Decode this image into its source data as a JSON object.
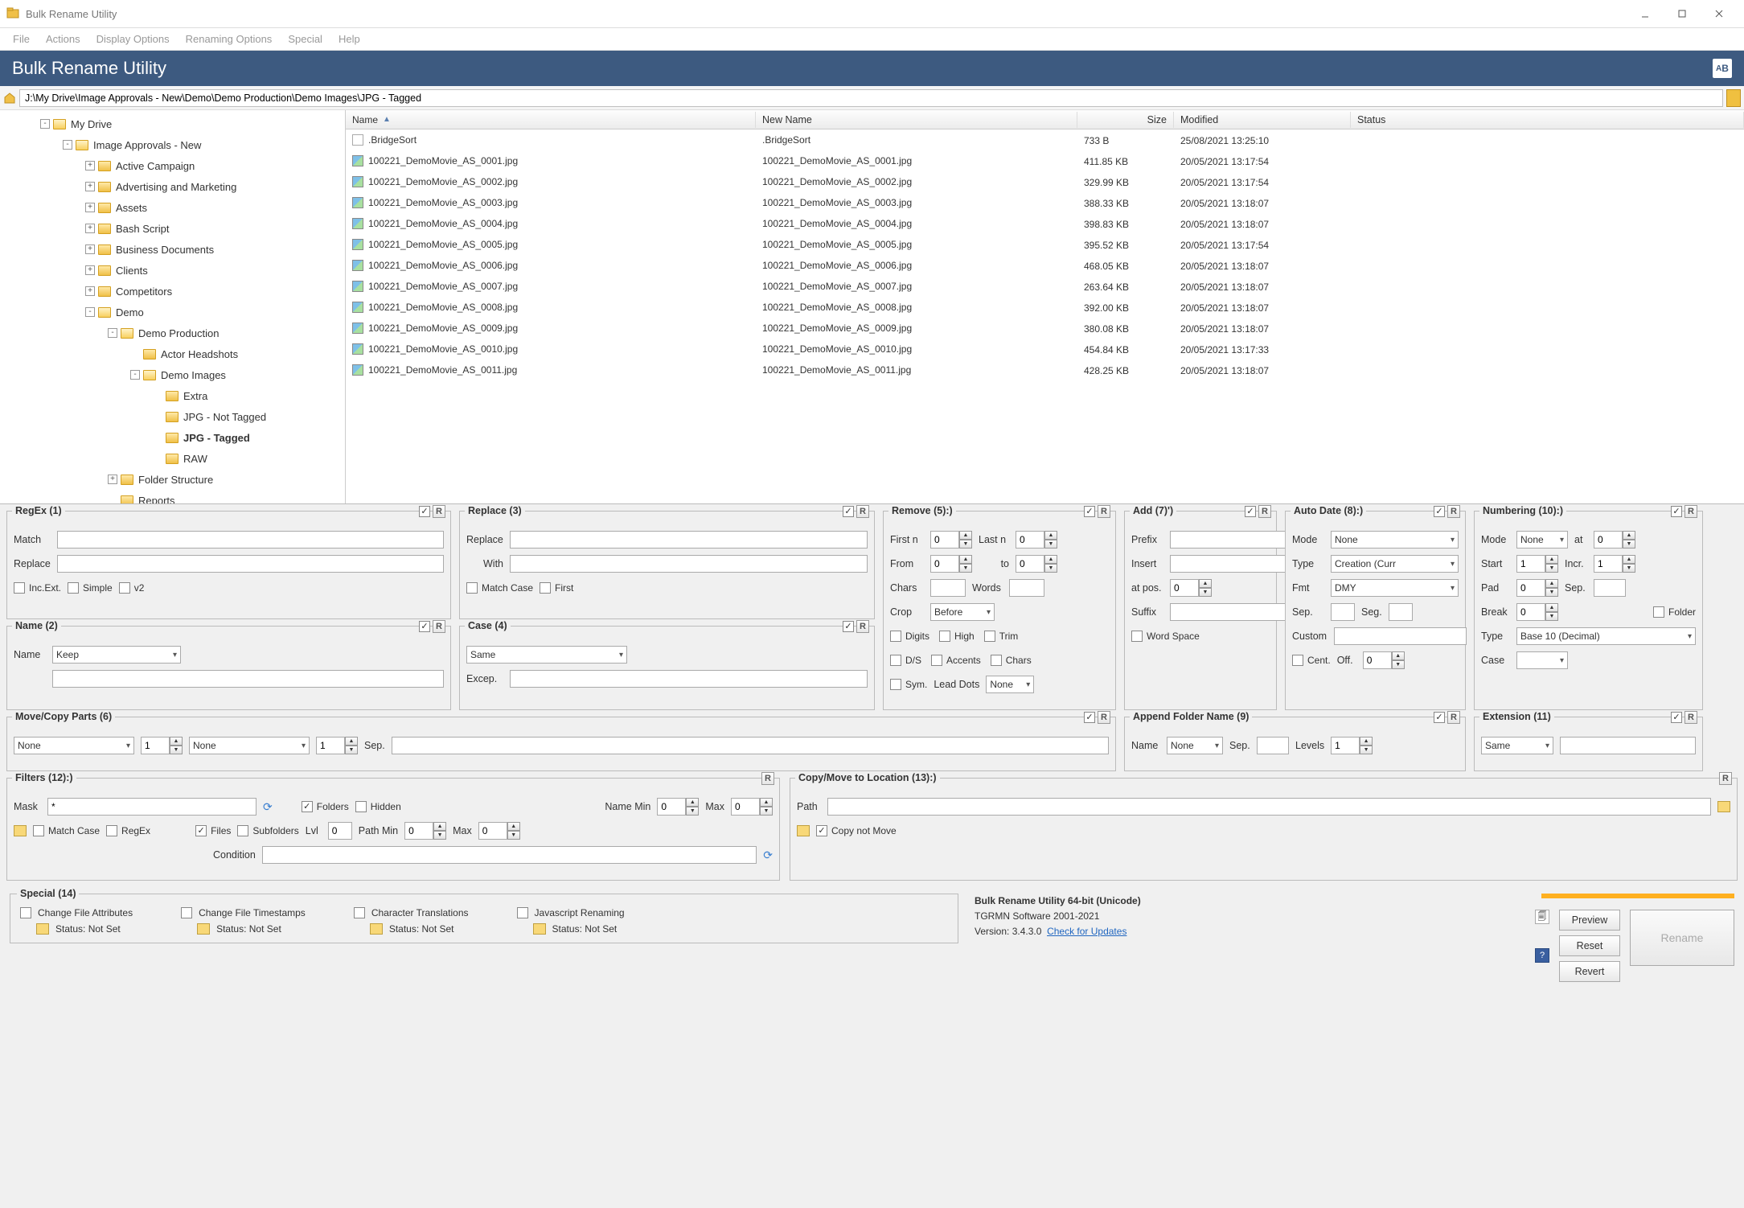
{
  "window": {
    "title": "Bulk Rename Utility"
  },
  "menu": [
    "File",
    "Actions",
    "Display Options",
    "Renaming Options",
    "Special",
    "Help"
  ],
  "banner": {
    "app_name": "Bulk Rename Utility"
  },
  "path": "J:\\My Drive\\Image Approvals - New\\Demo\\Demo Production\\Demo Images\\JPG - Tagged",
  "tree": [
    {
      "depth": 0,
      "toggle": "-",
      "label": "My Drive",
      "open": true
    },
    {
      "depth": 1,
      "toggle": "-",
      "label": "Image Approvals - New",
      "open": true
    },
    {
      "depth": 2,
      "toggle": "+",
      "label": "Active Campaign"
    },
    {
      "depth": 2,
      "toggle": "+",
      "label": "Advertising and Marketing"
    },
    {
      "depth": 2,
      "toggle": "+",
      "label": "Assets"
    },
    {
      "depth": 2,
      "toggle": "+",
      "label": "Bash Script"
    },
    {
      "depth": 2,
      "toggle": "+",
      "label": "Business Documents"
    },
    {
      "depth": 2,
      "toggle": "+",
      "label": "Clients"
    },
    {
      "depth": 2,
      "toggle": "+",
      "label": "Competitors"
    },
    {
      "depth": 2,
      "toggle": "-",
      "label": "Demo",
      "open": true
    },
    {
      "depth": 3,
      "toggle": "-",
      "label": "Demo Production",
      "open": true
    },
    {
      "depth": 4,
      "toggle": "",
      "label": "Actor Headshots"
    },
    {
      "depth": 4,
      "toggle": "-",
      "label": "Demo Images",
      "open": true
    },
    {
      "depth": 5,
      "toggle": "",
      "label": "Extra"
    },
    {
      "depth": 5,
      "toggle": "",
      "label": "JPG - Not Tagged"
    },
    {
      "depth": 5,
      "toggle": "",
      "label": "JPG - Tagged",
      "bold": true
    },
    {
      "depth": 5,
      "toggle": "",
      "label": "RAW"
    },
    {
      "depth": 3,
      "toggle": "+",
      "label": "Folder Structure"
    },
    {
      "depth": 3,
      "toggle": "",
      "label": "Reports"
    }
  ],
  "columns": {
    "name": "Name",
    "newname": "New Name",
    "size": "Size",
    "modified": "Modified",
    "status": "Status"
  },
  "files": [
    {
      "icon": "sort",
      "name": ".BridgeSort",
      "newname": ".BridgeSort",
      "size": "733 B",
      "modified": "25/08/2021 13:25:10"
    },
    {
      "icon": "img",
      "name": "100221_DemoMovie_AS_0001.jpg",
      "newname": "100221_DemoMovie_AS_0001.jpg",
      "size": "411.85 KB",
      "modified": "20/05/2021 13:17:54"
    },
    {
      "icon": "img",
      "name": "100221_DemoMovie_AS_0002.jpg",
      "newname": "100221_DemoMovie_AS_0002.jpg",
      "size": "329.99 KB",
      "modified": "20/05/2021 13:17:54"
    },
    {
      "icon": "img",
      "name": "100221_DemoMovie_AS_0003.jpg",
      "newname": "100221_DemoMovie_AS_0003.jpg",
      "size": "388.33 KB",
      "modified": "20/05/2021 13:18:07"
    },
    {
      "icon": "img",
      "name": "100221_DemoMovie_AS_0004.jpg",
      "newname": "100221_DemoMovie_AS_0004.jpg",
      "size": "398.83 KB",
      "modified": "20/05/2021 13:18:07"
    },
    {
      "icon": "img",
      "name": "100221_DemoMovie_AS_0005.jpg",
      "newname": "100221_DemoMovie_AS_0005.jpg",
      "size": "395.52 KB",
      "modified": "20/05/2021 13:17:54"
    },
    {
      "icon": "img",
      "name": "100221_DemoMovie_AS_0006.jpg",
      "newname": "100221_DemoMovie_AS_0006.jpg",
      "size": "468.05 KB",
      "modified": "20/05/2021 13:18:07"
    },
    {
      "icon": "img",
      "name": "100221_DemoMovie_AS_0007.jpg",
      "newname": "100221_DemoMovie_AS_0007.jpg",
      "size": "263.64 KB",
      "modified": "20/05/2021 13:18:07"
    },
    {
      "icon": "img",
      "name": "100221_DemoMovie_AS_0008.jpg",
      "newname": "100221_DemoMovie_AS_0008.jpg",
      "size": "392.00 KB",
      "modified": "20/05/2021 13:18:07"
    },
    {
      "icon": "img",
      "name": "100221_DemoMovie_AS_0009.jpg",
      "newname": "100221_DemoMovie_AS_0009.jpg",
      "size": "380.08 KB",
      "modified": "20/05/2021 13:18:07"
    },
    {
      "icon": "img",
      "name": "100221_DemoMovie_AS_0010.jpg",
      "newname": "100221_DemoMovie_AS_0010.jpg",
      "size": "454.84 KB",
      "modified": "20/05/2021 13:17:33"
    },
    {
      "icon": "img",
      "name": "100221_DemoMovie_AS_0011.jpg",
      "newname": "100221_DemoMovie_AS_0011.jpg",
      "size": "428.25 KB",
      "modified": "20/05/2021 13:18:07"
    }
  ],
  "boxes": {
    "regex": {
      "title": "RegEx (1)",
      "match": "Match",
      "replace": "Replace",
      "incext": "Inc.Ext.",
      "simple": "Simple",
      "v2": "v2"
    },
    "replace": {
      "title": "Replace (3)",
      "replace": "Replace",
      "with": "With",
      "matchcase": "Match Case",
      "first": "First"
    },
    "remove": {
      "title": "Remove (5):)",
      "firstn": "First n",
      "lastn": "Last n",
      "from": "From",
      "to": "to",
      "chars": "Chars",
      "words": "Words",
      "crop": "Crop",
      "crop_val": "Before",
      "digits": "Digits",
      "high": "High",
      "ds": "D/S",
      "accents": "Accents",
      "trim": "Trim",
      "chars2": "Chars",
      "sym": "Sym.",
      "leaddots": "Lead Dots",
      "leaddots_val": "None"
    },
    "add": {
      "title": "Add (7)')",
      "prefix": "Prefix",
      "insert": "Insert",
      "atpos": "at pos.",
      "suffix": "Suffix",
      "wordspace": "Word Space"
    },
    "autodate": {
      "title": "Auto Date (8):)",
      "mode": "Mode",
      "mode_val": "None",
      "type": "Type",
      "type_val": "Creation (Curr",
      "fmt": "Fmt",
      "fmt_val": "DMY",
      "sep": "Sep.",
      "seg": "Seg.",
      "custom": "Custom",
      "cent": "Cent.",
      "off": "Off."
    },
    "numbering": {
      "title": "Numbering (10):)",
      "mode": "Mode",
      "mode_val": "None",
      "at": "at",
      "start": "Start",
      "incr": "Incr.",
      "pad": "Pad",
      "sep": "Sep.",
      "break": "Break",
      "folder": "Folder",
      "type": "Type",
      "type_val": "Base 10 (Decimal)",
      "case": "Case"
    },
    "name": {
      "title": "Name (2)",
      "name": "Name",
      "name_val": "Keep"
    },
    "case": {
      "title": "Case (4)",
      "val": "Same",
      "excep": "Excep."
    },
    "move": {
      "title": "Move/Copy Parts (6)",
      "none": "None",
      "sep": "Sep."
    },
    "appfolder": {
      "title": "Append Folder Name (9)",
      "name": "Name",
      "name_val": "None",
      "sep": "Sep.",
      "levels": "Levels"
    },
    "ext": {
      "title": "Extension (11)",
      "val": "Same"
    },
    "filters": {
      "title": "Filters (12):)",
      "mask": "Mask",
      "mask_val": "*",
      "matchcase": "Match Case",
      "regex": "RegEx",
      "folders": "Folders",
      "files": "Files",
      "hidden": "Hidden",
      "subfolders": "Subfolders",
      "lvl": "Lvl",
      "namemin": "Name Min",
      "max": "Max",
      "pathmin": "Path Min",
      "condition": "Condition"
    },
    "copymove": {
      "title": "Copy/Move to Location (13):)",
      "path": "Path",
      "copynotmove": "Copy not Move"
    }
  },
  "special": {
    "title": "Special (14)",
    "items": [
      {
        "label": "Change File Attributes",
        "status": "Status:  Not Set"
      },
      {
        "label": "Change File Timestamps",
        "status": "Status:  Not Set"
      },
      {
        "label": "Character Translations",
        "status": "Status:  Not Set"
      },
      {
        "label": "Javascript Renaming",
        "status": "Status:  Not Set"
      }
    ]
  },
  "info": {
    "app": "Bulk Rename Utility 64-bit (Unicode)",
    "vendor": "TGRMN Software 2001-2021",
    "version": "Version: 3.4.3.0",
    "check": "Check for Updates"
  },
  "buttons": {
    "preview": "Preview",
    "reset": "Reset",
    "revert": "Revert",
    "rename": "Rename"
  },
  "zeros": {
    "z": "0",
    "one": "1"
  }
}
